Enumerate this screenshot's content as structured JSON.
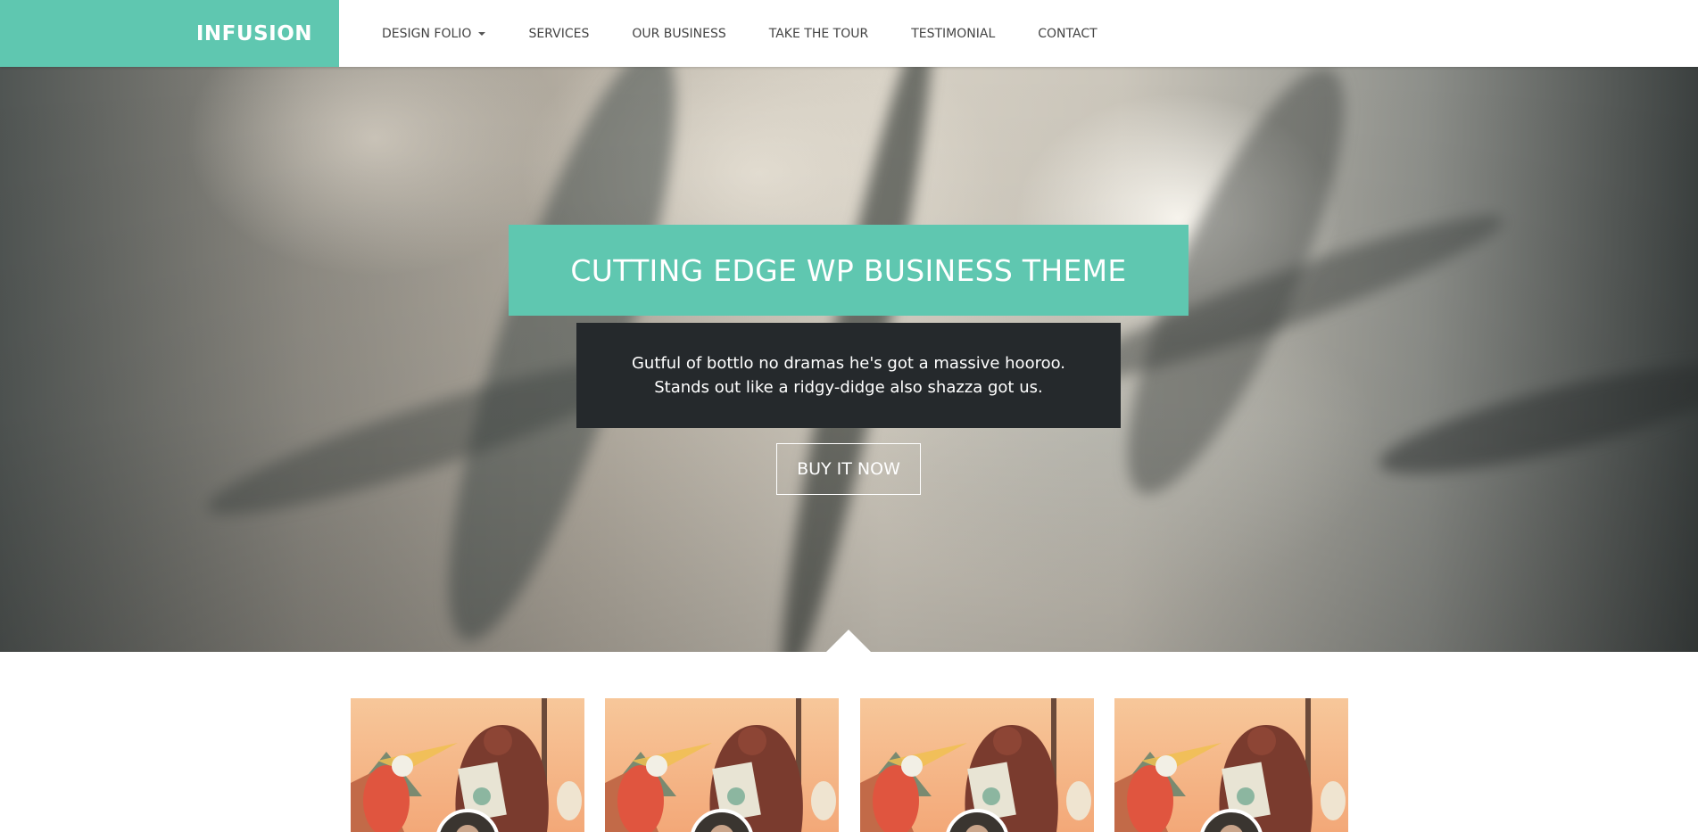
{
  "brand": {
    "name": "INFUSION"
  },
  "nav": {
    "items": [
      {
        "label": "DESIGN FOLIO",
        "has_dropdown": true,
        "icon": "caret-down-icon"
      },
      {
        "label": "SERVICES",
        "has_dropdown": false
      },
      {
        "label": "OUR BUSINESS",
        "has_dropdown": false
      },
      {
        "label": "TAKE THE TOUR",
        "has_dropdown": false
      },
      {
        "label": "TESTIMONIAL",
        "has_dropdown": false
      },
      {
        "label": "CONTACT",
        "has_dropdown": false
      }
    ]
  },
  "hero": {
    "title": "CUTTING EDGE WP BUSINESS THEME",
    "subtitle": "Gutful of bottlo no dramas he's got a massive hooroo. Stands out like a ridgy-didge also shazza got us.",
    "button_label": "BUY IT NOW"
  },
  "cards": [
    {
      "image": "illustration-cat-bear",
      "avatar": "avatar"
    },
    {
      "image": "illustration-cat-bear",
      "avatar": "avatar"
    },
    {
      "image": "illustration-cat-bear",
      "avatar": "avatar"
    },
    {
      "image": "illustration-cat-bear",
      "avatar": "avatar"
    }
  ],
  "colors": {
    "accent": "#5fc7b0",
    "dark_box": "#25292c",
    "nav_text": "#444444",
    "white": "#ffffff"
  }
}
